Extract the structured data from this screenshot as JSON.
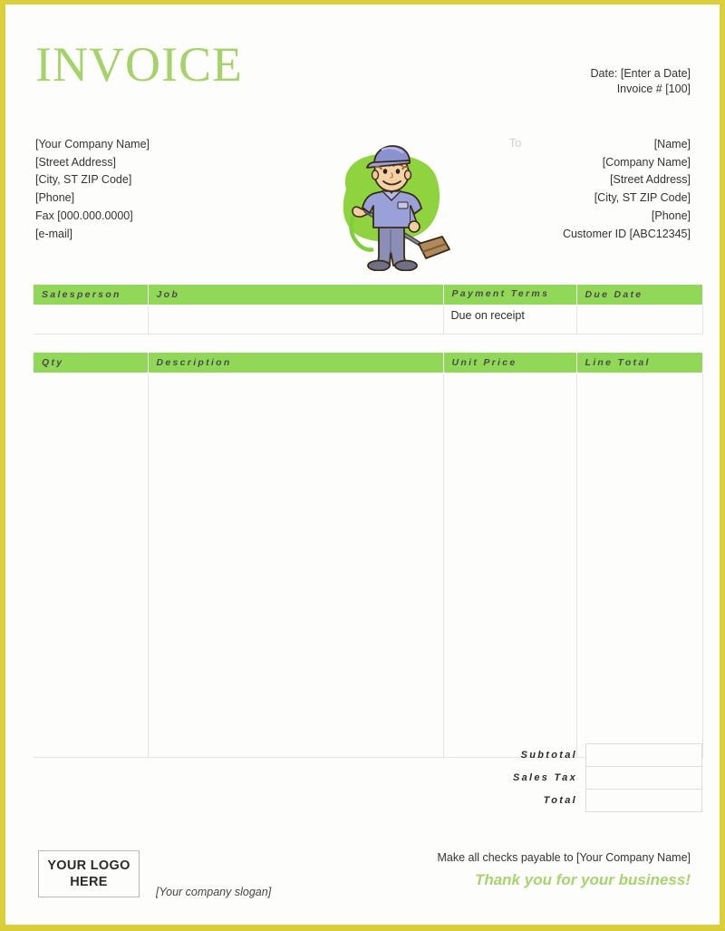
{
  "document": {
    "title": "INVOICE",
    "border_color": "#dbd03c",
    "accent_green": "#92d858",
    "title_green": "#a4d36a"
  },
  "meta": {
    "date_line": "Date: [Enter a Date]",
    "invoice_line": "Invoice # [100]"
  },
  "from": {
    "line1": "[Your Company Name]",
    "line2": "[Street Address]",
    "line3": "[City, ST  ZIP Code]",
    "line4": "[Phone]",
    "line5": "Fax [000.000.0000]",
    "line6": "[e-mail]"
  },
  "to": {
    "label": "To",
    "line1": "[Name]",
    "line2": "[Company Name]",
    "line3": "[Street Address]",
    "line4": "[City, ST  ZIP Code]",
    "line5": "[Phone]",
    "line6": "Customer ID [ABC12345]"
  },
  "mascot": {
    "name": "cleaner-mascot-illustration",
    "description": "cartoon cleaner with cap holding carpet cleaning wand on green blob"
  },
  "sales_table": {
    "headers": {
      "salesperson": "Salesperson",
      "job": "Job",
      "payment_terms": "Payment Terms",
      "due_date": "Due Date"
    },
    "row": {
      "salesperson": "",
      "job": "",
      "payment_terms": "Due on receipt",
      "due_date": ""
    }
  },
  "items_table": {
    "headers": {
      "qty": "Qty",
      "description": "Description",
      "unit_price": "Unit Price",
      "line_total": "Line Total"
    },
    "rows": []
  },
  "totals": {
    "subtotal_label": "Subtotal",
    "subtotal_value": "",
    "sales_tax_label": "Sales Tax",
    "sales_tax_value": "",
    "total_label": "Total",
    "total_value": ""
  },
  "footer": {
    "logo_line1": "YOUR LOGO",
    "logo_line2": "HERE",
    "slogan": "[Your company slogan]",
    "payable": "Make all checks payable to [Your Company Name]",
    "thanks": "Thank you for your business!"
  }
}
